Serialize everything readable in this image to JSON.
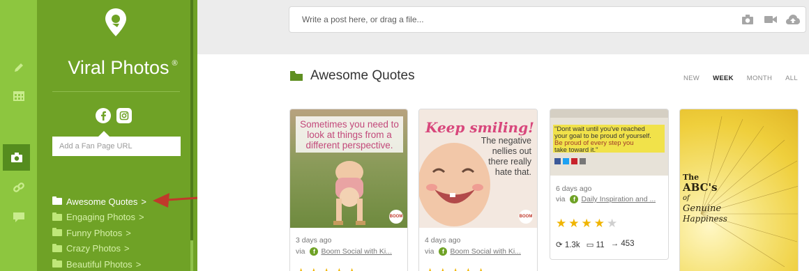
{
  "rail": {
    "items": [
      {
        "icon": "pencil-icon"
      },
      {
        "icon": "calendar-icon"
      },
      {
        "icon": "camera-icon",
        "active": true
      },
      {
        "icon": "link-icon"
      },
      {
        "icon": "comment-icon"
      }
    ]
  },
  "sidebar": {
    "brand": "Viral Photos",
    "brand_mark": "®",
    "fan_page_placeholder": "Add a Fan Page URL",
    "folders": [
      {
        "label": "Awesome Quotes",
        "chevron": ">",
        "active": true
      },
      {
        "label": "Engaging Photos",
        "chevron": ">"
      },
      {
        "label": "Funny Photos",
        "chevron": ">"
      },
      {
        "label": "Crazy Photos",
        "chevron": ">"
      },
      {
        "label": "Beautiful Photos",
        "chevron": ">"
      }
    ]
  },
  "composer": {
    "placeholder": "Write a post here, or drag a file..."
  },
  "section": {
    "title": "Awesome Quotes",
    "filters": [
      "NEW",
      "WEEK",
      "MONTH",
      "ALL"
    ],
    "active_filter": "WEEK"
  },
  "cards": [
    {
      "quote": [
        "Sometimes you need to",
        "look at things from a",
        "different perspective."
      ],
      "badge": "BOOM",
      "time": "3 days ago",
      "via": "via",
      "source": "Boom Social with Ki..."
    },
    {
      "quote_title": "Keep smiling!",
      "quote": [
        "The negative",
        "nellies out",
        "there really",
        "hate that."
      ],
      "badge": "BOOM",
      "time": "4 days ago",
      "via": "via",
      "source": "Boom Social with Ki..."
    },
    {
      "quote": [
        "\"Dont wait until you've reached",
        "your goal to be proud of yourself.",
        "Be proud of every step you",
        "take toward it.\""
      ],
      "time": "6 days ago",
      "via": "via",
      "source": "Daily Inspiration and ...",
      "rating": 4,
      "rating_max": 5,
      "shares": "1.3k",
      "comments": "11",
      "forwards": "453"
    },
    {
      "poster_title": [
        "The",
        "ABC's",
        "of",
        "Genuine",
        "Happiness"
      ]
    }
  ],
  "colors": {
    "rail": "#8dc63f",
    "sidebar": "#6fa226",
    "accent": "#5f8f22",
    "star": "#f0b400"
  }
}
